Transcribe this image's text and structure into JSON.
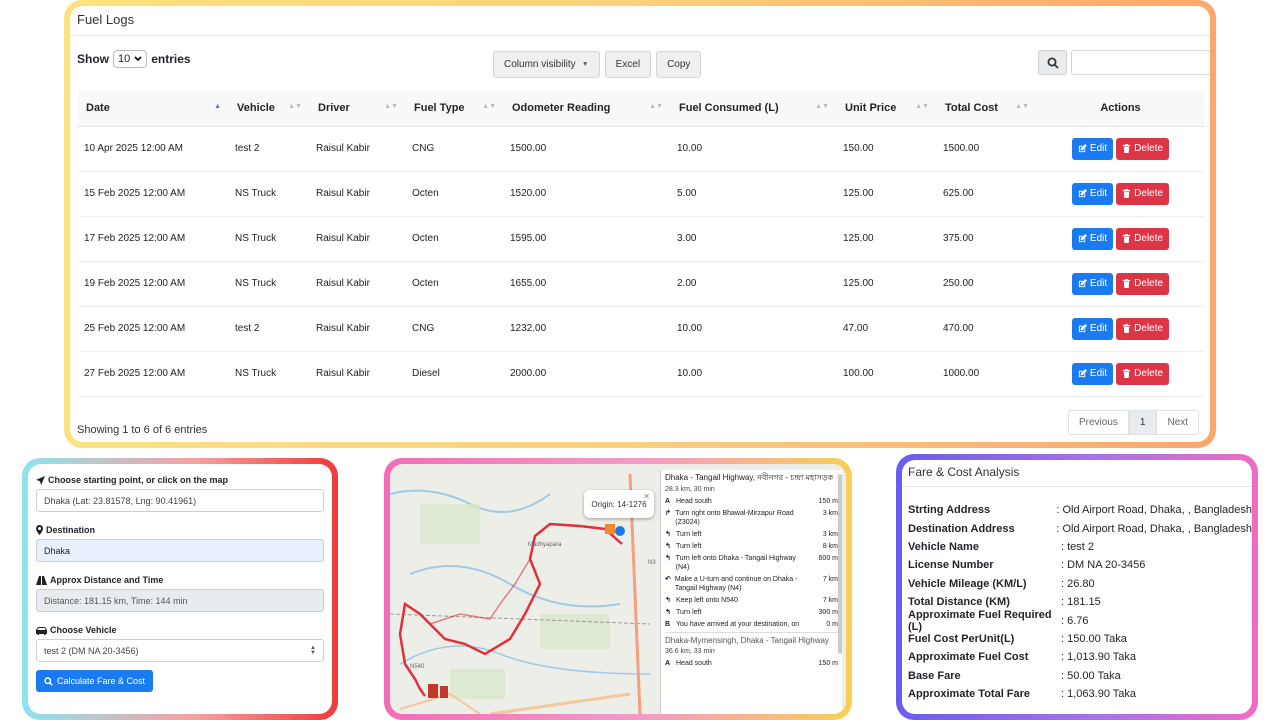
{
  "fuel_logs": {
    "title": "Fuel Logs",
    "show_label": "Show",
    "entries_value": "10",
    "entries_label": "entries",
    "buttons": {
      "column_visibility": "Column visibility",
      "excel": "Excel",
      "copy": "Copy"
    },
    "columns": [
      "Date",
      "Vehicle",
      "Driver",
      "Fuel Type",
      "Odometer Reading",
      "Fuel Consumed (L)",
      "Unit Price",
      "Total Cost",
      "Actions"
    ],
    "rows": [
      {
        "date": "10 Apr 2025 12:00 AM",
        "vehicle": "test 2",
        "driver": "Raisul Kabir",
        "fuel_type": "CNG",
        "odometer": "1500.00",
        "consumed": "10.00",
        "unit_price": "150.00",
        "total": "1500.00"
      },
      {
        "date": "15 Feb 2025 12:00 AM",
        "vehicle": "NS Truck",
        "driver": "Raisul Kabir",
        "fuel_type": "Octen",
        "odometer": "1520.00",
        "consumed": "5.00",
        "unit_price": "125.00",
        "total": "625.00"
      },
      {
        "date": "17 Feb 2025 12:00 AM",
        "vehicle": "NS Truck",
        "driver": "Raisul Kabir",
        "fuel_type": "Octen",
        "odometer": "1595.00",
        "consumed": "3.00",
        "unit_price": "125.00",
        "total": "375.00"
      },
      {
        "date": "19 Feb 2025 12:00 AM",
        "vehicle": "NS Truck",
        "driver": "Raisul Kabir",
        "fuel_type": "Octen",
        "odometer": "1655.00",
        "consumed": "2.00",
        "unit_price": "125.00",
        "total": "250.00"
      },
      {
        "date": "25 Feb 2025 12:00 AM",
        "vehicle": "test 2",
        "driver": "Raisul Kabir",
        "fuel_type": "CNG",
        "odometer": "1232.00",
        "consumed": "10.00",
        "unit_price": "47.00",
        "total": "470.00"
      },
      {
        "date": "27 Feb 2025 12:00 AM",
        "vehicle": "NS Truck",
        "driver": "Raisul Kabir",
        "fuel_type": "Diesel",
        "odometer": "2000.00",
        "consumed": "10.00",
        "unit_price": "100.00",
        "total": "1000.00"
      }
    ],
    "edit_label": "Edit",
    "delete_label": "Delete",
    "showing_text": "Showing 1 to 6 of 6 entries",
    "pager": {
      "previous": "Previous",
      "page": "1",
      "next": "Next"
    }
  },
  "route": {
    "start_label": "Choose starting point, or click on the map",
    "start_value": "Dhaka (Lat: 23.81578, Lng: 90.41961)",
    "destination_label": "Destination",
    "destination_value": "Dhaka",
    "distance_label": "Approx Distance and Time",
    "distance_value": "Distance: 181.15 km, Time: 144 min",
    "vehicle_label": "Choose Vehicle",
    "vehicle_value": "test 2 (DM NA 20-3456)",
    "calc_button": "Calculate Fare & Cost"
  },
  "map": {
    "popup": "Origin: 14-1276",
    "route_title": "Dhaka - Tangail Highway, নবীনগর - চন্দ্রা মহাসড়ক",
    "route_summary": "28.3 km, 30 min",
    "steps": [
      {
        "icon": "A",
        "text": "Head south",
        "dist": "150 m"
      },
      {
        "icon": "↱",
        "text": "Turn right onto Bhawal-Mirzapur Road (Z3024)",
        "dist": "3 km"
      },
      {
        "icon": "↰",
        "text": "Turn left",
        "dist": "3 km"
      },
      {
        "icon": "↰",
        "text": "Turn left",
        "dist": "8 km"
      },
      {
        "icon": "↰",
        "text": "Turn left onto Dhaka - Tangail Highway (N4)",
        "dist": "600 m"
      },
      {
        "icon": "↶",
        "text": "Make a U-turn and continue on Dhaka - Tangail Highway (N4)",
        "dist": "7 km"
      },
      {
        "icon": "↰",
        "text": "Keep left onto N540",
        "dist": "7 km"
      },
      {
        "icon": "↰",
        "text": "Turn left",
        "dist": "300 m"
      },
      {
        "icon": "B",
        "text": "You have arrived at your destination, on",
        "dist": "0 m"
      }
    ],
    "alt_title": "Dhaka-Mymensingh, Dhaka - Tangail Highway",
    "alt_summary": "36.6 km, 33 min",
    "alt_step": {
      "icon": "A",
      "text": "Head south",
      "dist": "150 m"
    },
    "labels": {
      "madhyapara": "Madhyapara",
      "n3": "N3",
      "n540": "N540"
    }
  },
  "fare": {
    "title": "Fare & Cost Analysis",
    "rows": [
      {
        "k": "Strting Address",
        "v": ": Old Airport Road, Dhaka, , Bangladesh"
      },
      {
        "k": "Destination Address",
        "v": ": Old Airport Road, Dhaka, , Bangladesh"
      },
      {
        "k": "Vehicle Name",
        "v": ": test 2"
      },
      {
        "k": "License Number",
        "v": ": DM NA 20-3456"
      },
      {
        "k": "Vehicle Mileage (KM/L)",
        "v": ": 26.80"
      },
      {
        "k": "Total Distance (KM)",
        "v": ": 181.15"
      },
      {
        "k": "Approximate Fuel Required (L)",
        "v": ": 6.76"
      },
      {
        "k": "Fuel Cost PerUnit(L)",
        "v": ": 150.00 Taka"
      },
      {
        "k": "Approximate Fuel Cost",
        "v": ": 1,013.90 Taka"
      },
      {
        "k": "Base Fare",
        "v": ": 50.00 Taka"
      },
      {
        "k": "Approximate Total Fare",
        "v": ": 1,063.90 Taka"
      }
    ]
  },
  "colors": {
    "primary": "#1a7bf0",
    "danger": "#dc3545",
    "route": "#e0303a"
  }
}
